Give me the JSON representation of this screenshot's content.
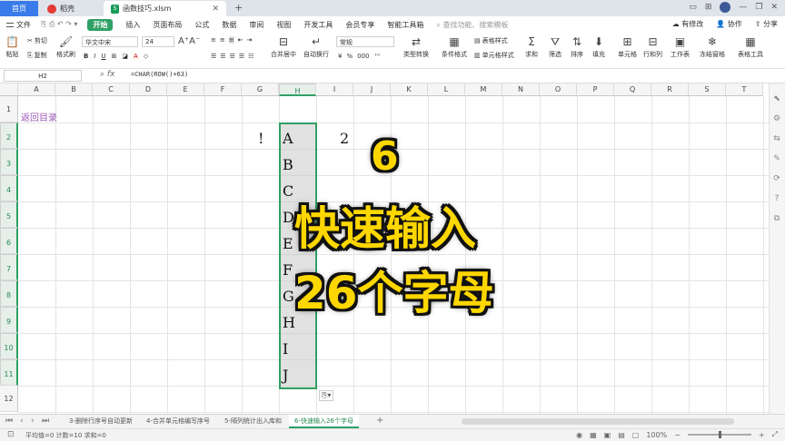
{
  "titlebar": {
    "tabs": [
      {
        "label": "首页"
      },
      {
        "label": "稻壳"
      },
      {
        "label": "函数技巧.xlsm"
      }
    ],
    "new_tab": "+"
  },
  "menubar": {
    "file": "文件",
    "items": [
      "开始",
      "插入",
      "页面布局",
      "公式",
      "数据",
      "审阅",
      "视图",
      "开发工具",
      "会员专享",
      "智能工具箱"
    ],
    "active": "开始",
    "search_placeholder": "查找功能、搜索模板",
    "right": [
      "有修改",
      "协作",
      "分享"
    ]
  },
  "ribbon": {
    "paste": "粘贴",
    "cut": "剪切",
    "copy": "复制",
    "format_painter": "格式刷",
    "font_name": "华文中宋",
    "font_size": "24",
    "merge_center": "合并居中",
    "wrap_text": "自动换行",
    "number_format": "常规",
    "type_convert": "类型转换",
    "conditional_format": "条件格式",
    "table_style": "表格样式",
    "cell_style": "单元格样式",
    "sum": "求和",
    "filter": "筛选",
    "sort": "排序",
    "fill": "填充",
    "cell": "单元格",
    "row_col": "行和列",
    "worksheet": "工作表",
    "freeze": "冻结窗格",
    "table_tools": "表格工具"
  },
  "formula_bar": {
    "cell_ref": "H2",
    "fx": "fx",
    "formula": "=CHAR(ROW()+63)"
  },
  "grid": {
    "columns": [
      "A",
      "B",
      "C",
      "D",
      "E",
      "F",
      "G",
      "H",
      "I",
      "J",
      "K",
      "L",
      "M",
      "N",
      "O",
      "P",
      "Q",
      "R",
      "S",
      "T"
    ],
    "rows": [
      "1",
      "2",
      "3",
      "4",
      "5",
      "6",
      "7",
      "8",
      "9",
      "10",
      "11",
      "12"
    ],
    "selected_column": "H",
    "link_text": "返回目录",
    "g2": "!",
    "i2": "2",
    "h_values": [
      "A",
      "B",
      "C",
      "D",
      "E",
      "F",
      "G",
      "H",
      "I",
      "J"
    ],
    "paste_options": "⎘▾"
  },
  "overlay": {
    "number": "6",
    "line1": "快速输入",
    "line2": "26个字母"
  },
  "sheets": {
    "tabs": [
      "3-删除行序号自动更新",
      "4-合并单元格编写序号",
      "5-隔列统计出入库和",
      "6-快速输入26个字母"
    ],
    "active_index": 3,
    "add": "+"
  },
  "status": {
    "summary": "平均值=0  计数=10  求和=0",
    "zoom": "100%"
  }
}
